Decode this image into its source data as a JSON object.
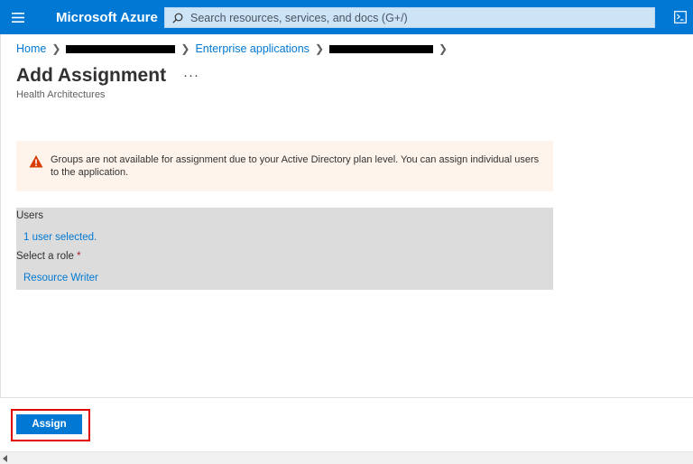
{
  "header": {
    "brand": "Microsoft Azure",
    "search_placeholder": "Search resources, services, and docs (G+/)",
    "icons": {
      "menu": "hamburger-icon",
      "search": "search-icon",
      "shell": "cloud-shell-icon"
    }
  },
  "breadcrumb": {
    "home": "Home",
    "enterprise": "Enterprise applications"
  },
  "page": {
    "title": "Add Assignment",
    "more": "···",
    "subtitle": "Health Architectures"
  },
  "warning": {
    "icon": "warning-icon",
    "text": "Groups are not available for assignment due to your Active Directory plan level. You can assign individual users to the application."
  },
  "form": {
    "users_label": "Users",
    "users_value": "1 user selected.",
    "role_label": "Select a role",
    "required_mark": "*",
    "role_value": "Resource Writer"
  },
  "footer": {
    "assign_label": "Assign"
  },
  "colors": {
    "accent": "#0078d4",
    "warning_bg": "#fff4ec",
    "warning_icon": "#d83b01",
    "panel_bg": "#dcdcdc",
    "highlight": "#e00000"
  }
}
